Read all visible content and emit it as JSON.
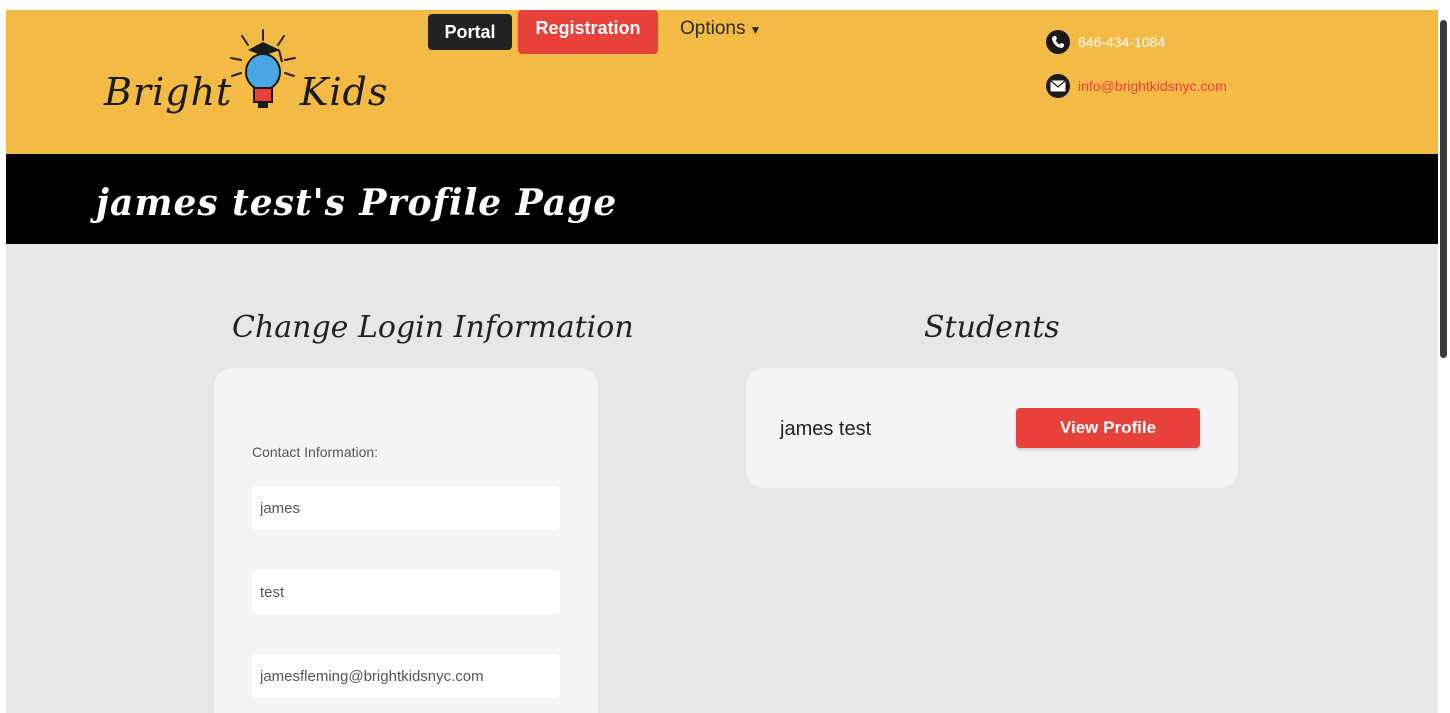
{
  "header": {
    "logo_text_left": "Bright",
    "logo_text_right": "Kids",
    "nav": {
      "portal": "Portal",
      "registration": "Registration",
      "options": "Options"
    },
    "phone": "646-434-1084",
    "email": "info@brightkidsnyc.com"
  },
  "page_title": "james test's Profile Page",
  "login_section": {
    "heading": "Change Login Information",
    "contact_label": "Contact Information:",
    "first_name": "james",
    "last_name": "test",
    "email": "jamesfleming@brightkidsnyc.com"
  },
  "students_section": {
    "heading": "Students",
    "students": [
      {
        "name": "james test",
        "button_label": "View Profile"
      }
    ]
  },
  "colors": {
    "header_bg": "#f3bb46",
    "accent_red": "#e8413c",
    "title_bg": "#000000"
  }
}
